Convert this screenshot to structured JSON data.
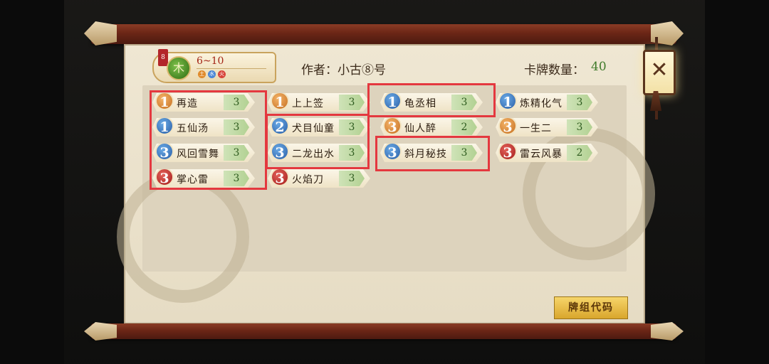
{
  "header": {
    "tag": "8",
    "level_icon": "木",
    "level_range": "6~10",
    "elements": [
      {
        "icon": "earth-icon",
        "glyph": "土",
        "color": "#e08a2a"
      },
      {
        "icon": "water-icon",
        "glyph": "水",
        "color": "#4a86d6"
      },
      {
        "icon": "fire-icon",
        "glyph": "火",
        "color": "#d8443a"
      }
    ],
    "author": "作者：小古⑧号",
    "count_label": "卡牌数量：",
    "count_value": "40"
  },
  "cards": [
    {
      "cost": "1",
      "color": "orange",
      "name": "再造",
      "count": "3"
    },
    {
      "cost": "1",
      "color": "orange",
      "name": "上上签",
      "count": "3"
    },
    {
      "cost": "1",
      "color": "blue",
      "name": "龟丞相",
      "count": "3"
    },
    {
      "cost": "1",
      "color": "blue",
      "name": "炼精化气",
      "count": "3"
    },
    {
      "cost": "1",
      "color": "blue",
      "name": "五仙汤",
      "count": "3"
    },
    {
      "cost": "2",
      "color": "blue",
      "name": "犬目仙童",
      "count": "3"
    },
    {
      "cost": "3",
      "color": "orange",
      "name": "仙人醉",
      "count": "2"
    },
    {
      "cost": "3",
      "color": "orange",
      "name": "一生二",
      "count": "3"
    },
    {
      "cost": "3",
      "color": "blue",
      "name": "风回雪舞",
      "count": "3"
    },
    {
      "cost": "3",
      "color": "blue",
      "name": "二龙出水",
      "count": "3"
    },
    {
      "cost": "3",
      "color": "blue",
      "name": "斜月秘技",
      "count": "3"
    },
    {
      "cost": "3",
      "color": "red",
      "name": "雷云风暴",
      "count": "2"
    },
    {
      "cost": "3",
      "color": "red",
      "name": "掌心雷",
      "count": "3"
    },
    {
      "cost": "3",
      "color": "red",
      "name": "火焰刀",
      "count": "3"
    }
  ],
  "deck_code_button": "牌组代码",
  "close_icon": "close-icon"
}
